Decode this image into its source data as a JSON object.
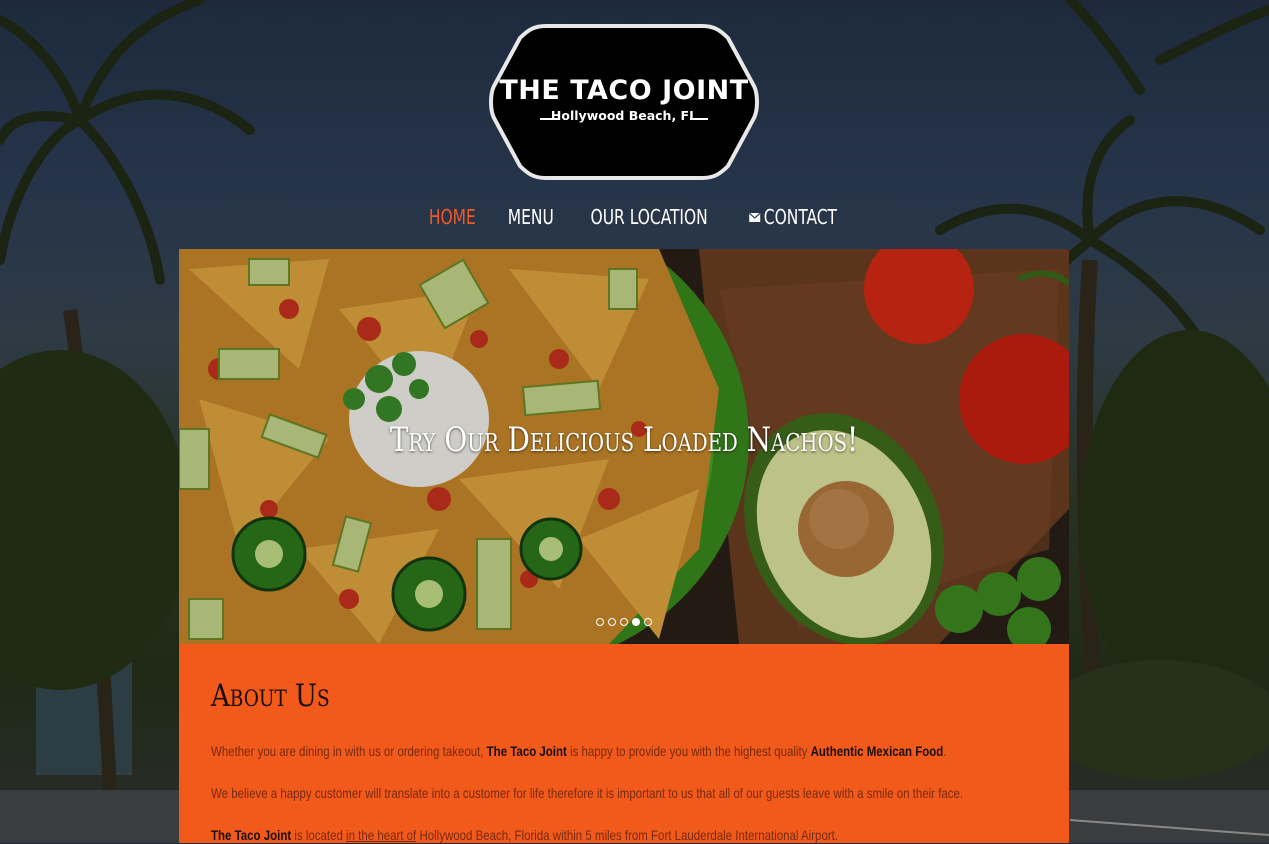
{
  "logo": {
    "title": "THE TACO JOINT",
    "subtitle": "Hollywood Beach, FL"
  },
  "nav": {
    "items": [
      {
        "label": "HOME",
        "active": true
      },
      {
        "label": "MENU",
        "active": false
      },
      {
        "label": "OUR LOCATION",
        "active": false
      },
      {
        "label": "CONTACT",
        "active": false,
        "icon": "mail-icon"
      }
    ]
  },
  "slider": {
    "caption": "Try Our Delicious Loaded Nachos!",
    "slide_count": 5,
    "active_slide": 4
  },
  "about": {
    "title": "About Us",
    "p1_a": "Whether you are dining in with us or ordering takeout, ",
    "p1_b": "The Taco Joint",
    "p1_c": " is happy to provide you with the highest quality ",
    "p1_d": "Authentic Mexican Food",
    "p1_e": ".",
    "p2": "We believe a happy customer will translate into a customer for life therefore it is important to us that all of our guests leave with a smile on their face.",
    "p3_a": "The Taco Joint",
    "p3_b": " is located ",
    "p3_c": "in the heart of",
    "p3_d": " Hollywood Beach, Florida within 5 miles from Fort Lauderdale International Airport."
  },
  "colors": {
    "accent": "#f15a24",
    "about_bg": "#f15a1a"
  }
}
